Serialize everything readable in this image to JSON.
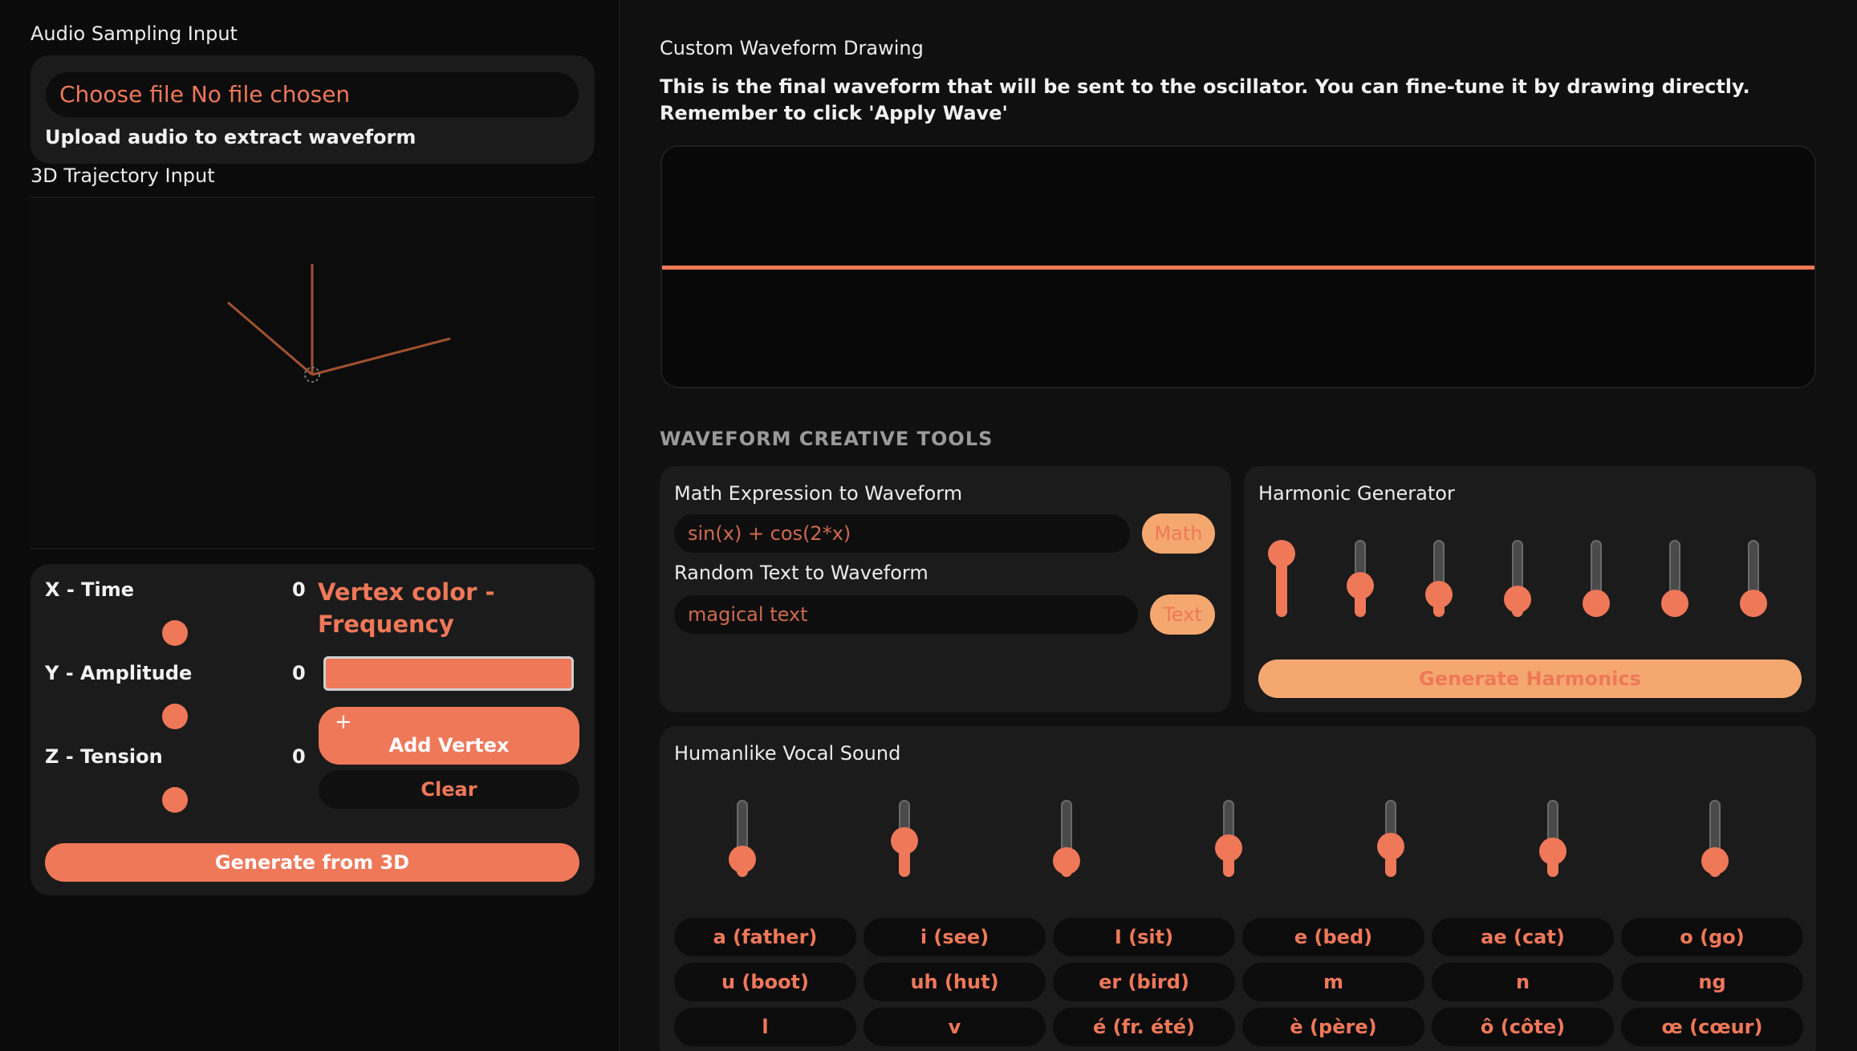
{
  "audio": {
    "title": "Audio Sampling Input",
    "file_button": "Choose file",
    "file_status": "No file chosen",
    "hint": "Upload audio to extract waveform"
  },
  "trajectory": {
    "title": "3D Trajectory Input",
    "controls": {
      "axes": [
        {
          "label": "X - Time",
          "value": "0"
        },
        {
          "label": "Y - Amplitude",
          "value": "0"
        },
        {
          "label": "Z - Tension",
          "value": "0"
        }
      ],
      "vertex_color_label": "Vertex color - Frequency",
      "vertex_color": "#ef7859",
      "add_vertex_icon": "+",
      "add_vertex_label": "Add Vertex",
      "clear_label": "Clear",
      "generate_label": "Generate from 3D"
    }
  },
  "waveform": {
    "title": "Custom Waveform Drawing",
    "description": "This is the final waveform that will be sent to the oscillator. You can fine-tune it by drawing directly. Remember to click 'Apply Wave'"
  },
  "tools": {
    "heading": "WAVEFORM CREATIVE TOOLS",
    "math": {
      "title": "Math Expression to Waveform",
      "placeholder": "sin(x) + cos(2*x)",
      "button": "Math"
    },
    "text": {
      "title": "Random Text to Waveform",
      "placeholder": "magical text",
      "button": "Text"
    },
    "harmonic": {
      "title": "Harmonic Generator",
      "levels": [
        1.0,
        0.5,
        0.35,
        0.28,
        0.2,
        0.18,
        0.15
      ],
      "button": "Generate Harmonics"
    },
    "vocal": {
      "title": "Humanlike Vocal Sound",
      "levels": [
        0.28,
        0.57,
        0.25,
        0.45,
        0.48,
        0.4,
        0.25
      ],
      "phonemes": [
        "a (father)",
        "i (see)",
        "I (sit)",
        "e (bed)",
        "ae (cat)",
        "o (go)",
        "u (boot)",
        "uh (hut)",
        "er (bird)",
        "m",
        "n",
        "ng",
        "l",
        "v",
        "é (fr. été)",
        "è (père)",
        "ô (côte)",
        "œ (cœur)"
      ]
    }
  },
  "colors": {
    "accent": "#ef7859",
    "accent_light": "#f4a870",
    "card": "#1b1b1b",
    "background": "#0b0b0b"
  }
}
